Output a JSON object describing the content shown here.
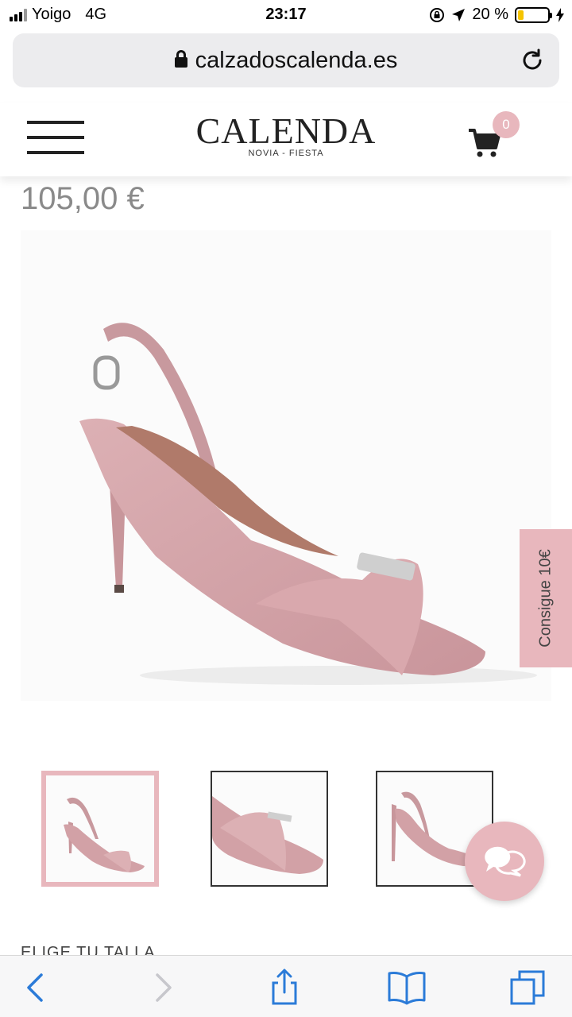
{
  "status_bar": {
    "carrier": "Yoigo",
    "network": "4G",
    "time": "23:17",
    "battery_percent": "20 %",
    "battery_level": 0.2
  },
  "browser": {
    "url": "calzadoscalenda.es"
  },
  "site": {
    "logo_name": "CALENDA",
    "logo_tagline": "NOVIA - FIESTA",
    "cart_count": "0"
  },
  "product": {
    "price": "105,00 €"
  },
  "promo_tab": {
    "label": "Consigue 10€"
  },
  "size_section": {
    "label": "ELIGE TU TALLA"
  },
  "colors": {
    "accent_pink": "#e8b7bd",
    "shoe_pink": "#d9a8ad",
    "ios_blue": "#2b7bd8"
  },
  "icons": [
    "signal-icon",
    "lock-icon",
    "reload-icon",
    "hamburger-icon",
    "cart-icon",
    "chat-icon",
    "back-icon",
    "forward-icon",
    "share-icon",
    "bookmarks-icon",
    "tabs-icon"
  ]
}
